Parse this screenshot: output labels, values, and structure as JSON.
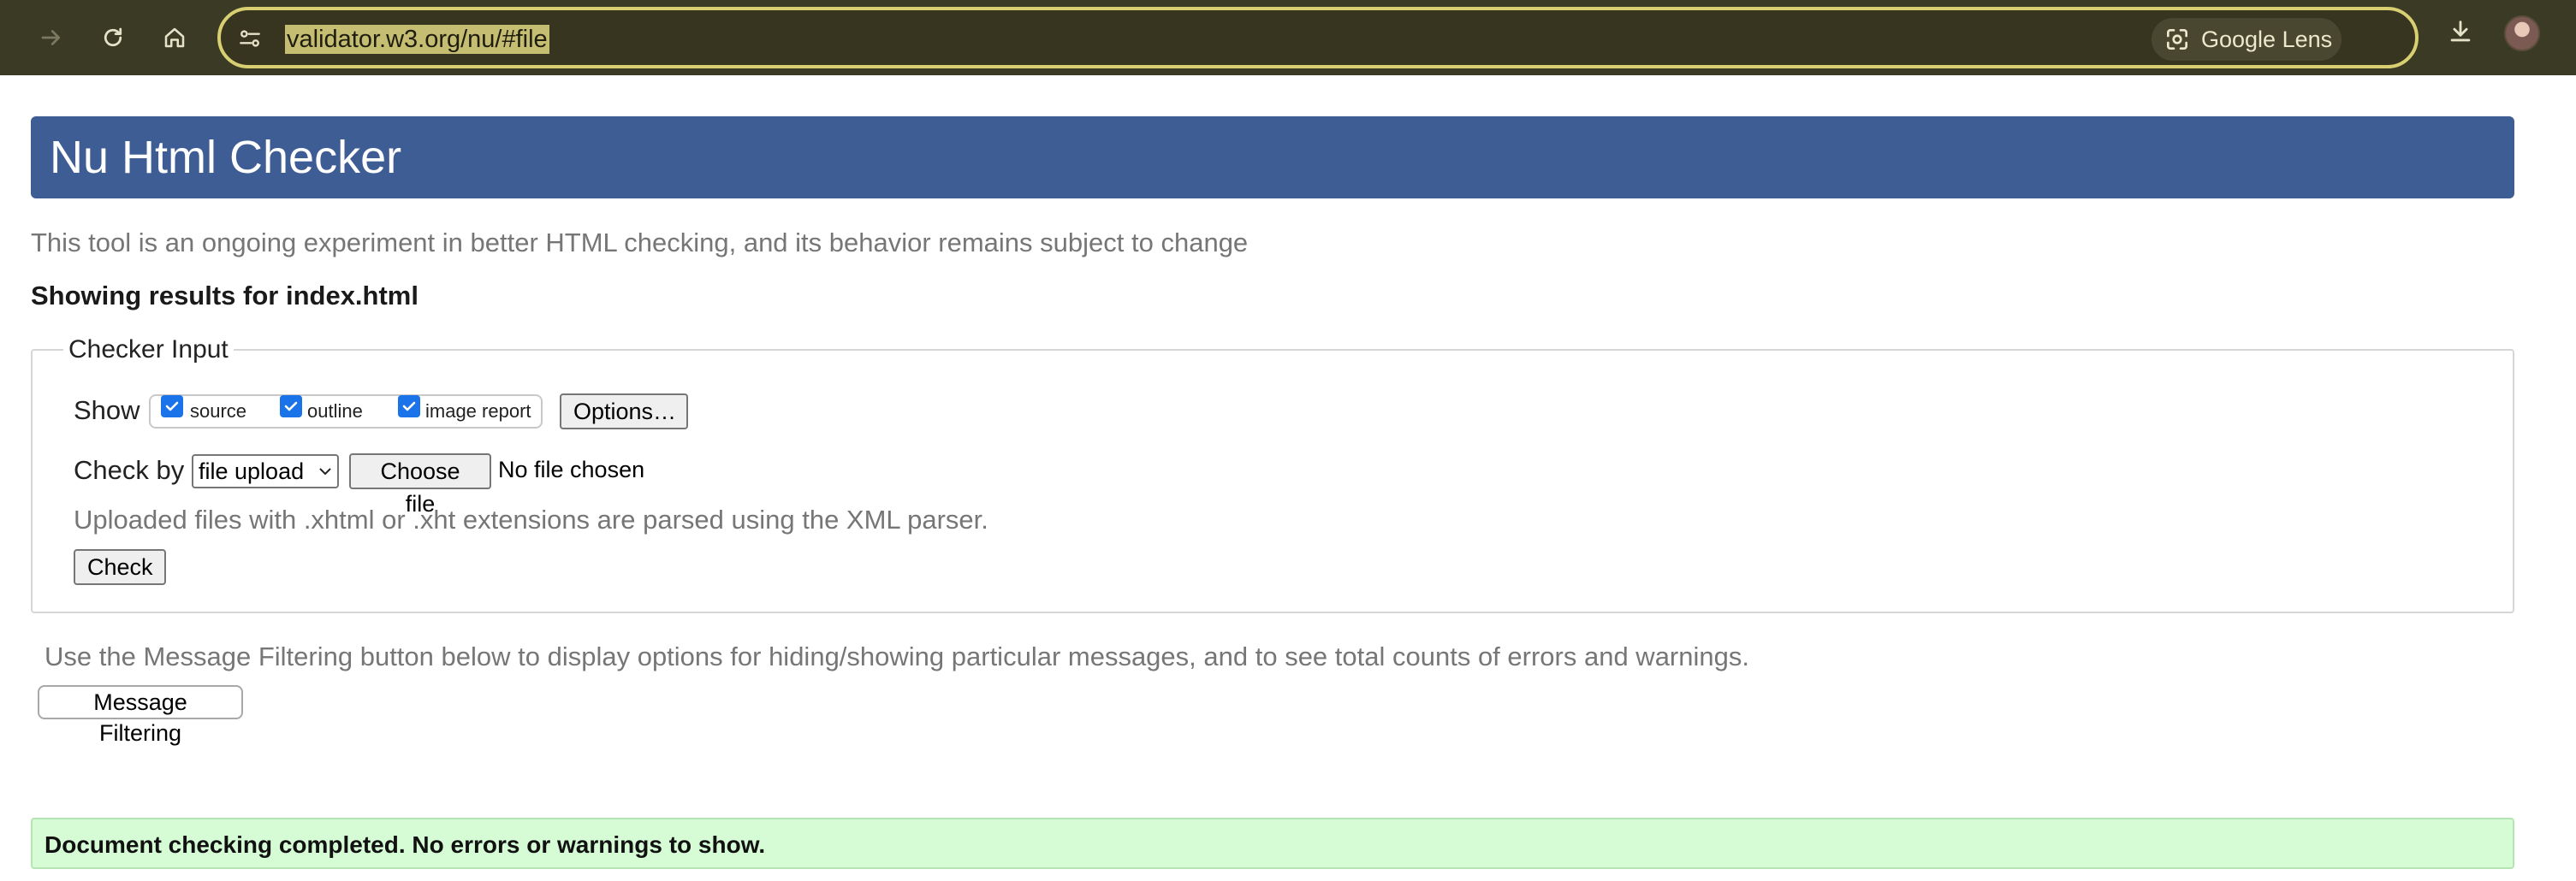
{
  "browser": {
    "url": "validator.w3.org/nu/#file",
    "lens_label": "Google Lens",
    "icons": [
      "forward-icon",
      "reload-icon",
      "home-icon",
      "site-info-icon",
      "google-lens-icon",
      "bookmark-star-icon",
      "download-icon",
      "profile-avatar"
    ],
    "chrome_color": "#3b3a25",
    "omnibox_border_color": "#d7cf71"
  },
  "page": {
    "title": "Nu Html Checker",
    "banner_color": "#3e5d95",
    "tagline": "This tool is an ongoing experiment in better HTML checking, and its behavior remains subject to change",
    "showing_results": "Showing results for index.html",
    "checker_input": {
      "legend": "Checker Input",
      "show_label": "Show",
      "show_options": [
        {
          "label": "source",
          "checked": true
        },
        {
          "label": "outline",
          "checked": true
        },
        {
          "label": "image report",
          "checked": true
        }
      ],
      "options_button": "Options…",
      "check_by_label": "Check by",
      "check_by_value": "file upload",
      "choose_file_button": "Choose file",
      "file_status": "No file chosen",
      "xml_note": "Uploaded files with .xhtml or .xht extensions are parsed using the XML parser.",
      "check_button": "Check"
    },
    "filter_note": "Use the Message Filtering button below to display options for hiding/showing particular messages, and to see total counts of errors and warnings.",
    "message_filtering_button": "Message Filtering",
    "status": {
      "text": "Document checking completed. No errors or warnings to show.",
      "background": "#d6fcd6"
    }
  }
}
